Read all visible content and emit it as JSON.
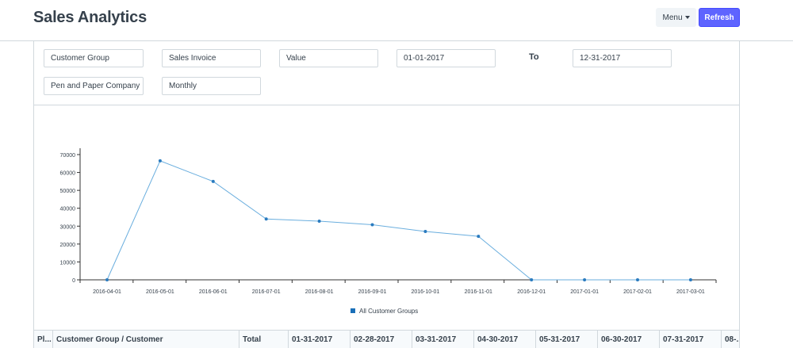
{
  "page": {
    "title": "Sales Analytics"
  },
  "actions": {
    "menu_label": "Menu",
    "refresh_label": "Refresh"
  },
  "filters": {
    "tree_type": "Customer Group",
    "doc_type": "Sales Invoice",
    "value_quantity": "Value",
    "from_date": "01-01-2017",
    "to_label": "To",
    "to_date": "12-31-2017",
    "company": "Pen and Paper Company",
    "range": "Monthly"
  },
  "chart_data": {
    "type": "line",
    "x": [
      "2016-04-01",
      "2016-05-01",
      "2016-06-01",
      "2016-07-01",
      "2016-08-01",
      "2016-09-01",
      "2016-10-01",
      "2016-11-01",
      "2016-12-01",
      "2017-01-01",
      "2017-02-01",
      "2017-03-01"
    ],
    "series": [
      {
        "name": "All Customer Groups",
        "values": [
          0,
          66500,
          55000,
          34000,
          32800,
          30800,
          27000,
          24300,
          0,
          0,
          0,
          0
        ]
      }
    ],
    "yticks": [
      0,
      10000,
      20000,
      30000,
      40000,
      50000,
      60000,
      70000
    ],
    "ylim": [
      0,
      70000
    ],
    "legend": "bottom-center",
    "grid": false,
    "line_color": "#6aaede",
    "point_color": "#2a7bbf",
    "legend_color": "#1a6fb8"
  },
  "table": {
    "headers": [
      "Pl...",
      "Customer Group / Customer",
      "Total",
      "01-31-2017",
      "02-28-2017",
      "03-31-2017",
      "04-30-2017",
      "05-31-2017",
      "06-30-2017",
      "07-31-2017",
      "08-..."
    ]
  }
}
